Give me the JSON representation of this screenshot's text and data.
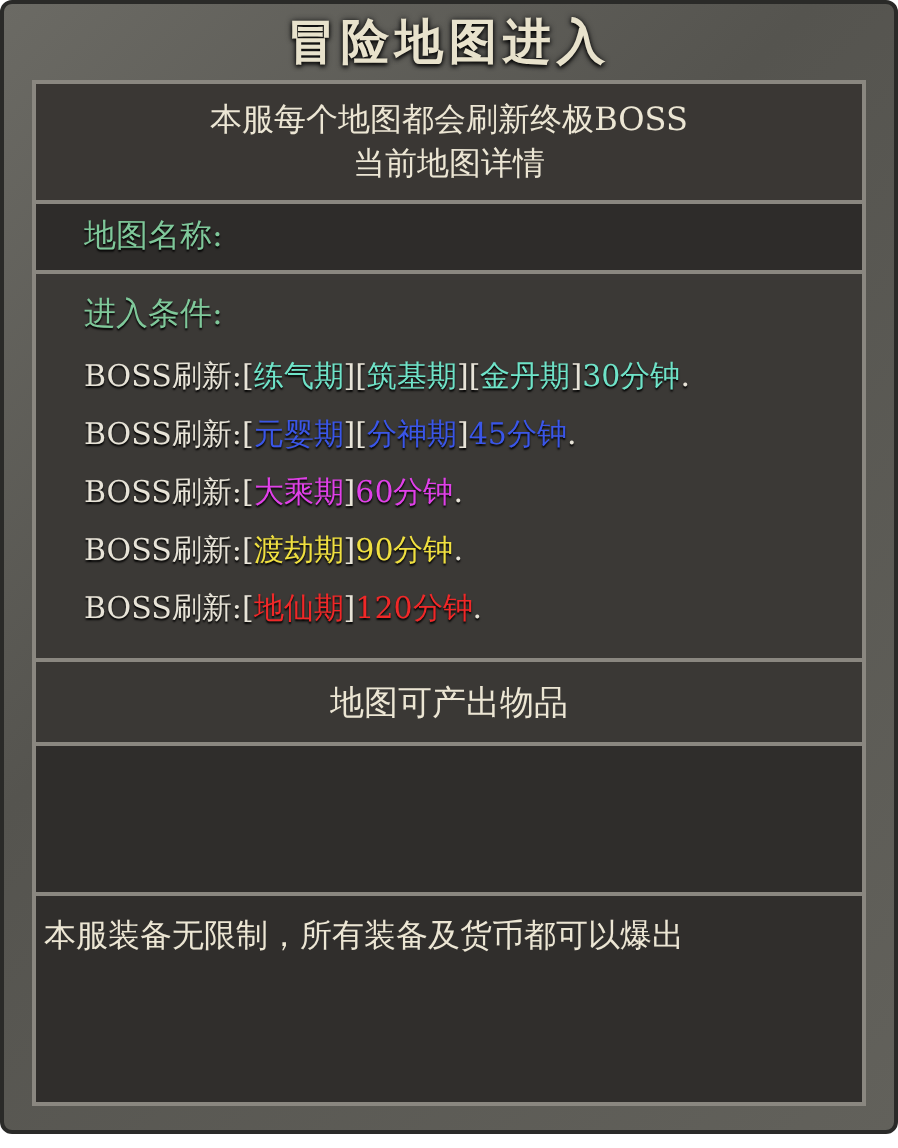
{
  "window": {
    "title": "冒险地图进入"
  },
  "header": {
    "lines": [
      "本服每个地图都会刷新终极BOSS",
      "当前地图详情"
    ]
  },
  "map_name": {
    "label": "地图名称:"
  },
  "conditions": {
    "label": "进入条件:",
    "rows": [
      {
        "segments": [
          {
            "text": "BOSS刷新:[",
            "color": "#e8e4d8"
          },
          {
            "text": "练气期",
            "color": "#6fe3c8"
          },
          {
            "text": "][",
            "color": "#e8e4d8"
          },
          {
            "text": "筑基期",
            "color": "#6fe3c8"
          },
          {
            "text": "][",
            "color": "#e8e4d8"
          },
          {
            "text": "金丹期",
            "color": "#6fe3c8"
          },
          {
            "text": "]",
            "color": "#e8e4d8"
          },
          {
            "text": "30分钟",
            "color": "#6fe3c8"
          },
          {
            "text": ".",
            "color": "#e8e4d8"
          }
        ]
      },
      {
        "segments": [
          {
            "text": "BOSS刷新:[",
            "color": "#e8e4d8"
          },
          {
            "text": "元婴期",
            "color": "#3a56e8"
          },
          {
            "text": "][",
            "color": "#e8e4d8"
          },
          {
            "text": "分神期",
            "color": "#3a56e8"
          },
          {
            "text": "]",
            "color": "#e8e4d8"
          },
          {
            "text": "45分钟",
            "color": "#3a56e8"
          },
          {
            "text": ".",
            "color": "#e8e4d8"
          }
        ]
      },
      {
        "segments": [
          {
            "text": "BOSS刷新:[",
            "color": "#e8e4d8"
          },
          {
            "text": "大乘期",
            "color": "#e040e8"
          },
          {
            "text": "]",
            "color": "#e8e4d8"
          },
          {
            "text": "60分钟",
            "color": "#e040e8"
          },
          {
            "text": ".",
            "color": "#e8e4d8"
          }
        ]
      },
      {
        "segments": [
          {
            "text": "BOSS刷新:[",
            "color": "#e8e4d8"
          },
          {
            "text": "渡劫期",
            "color": "#f0e040"
          },
          {
            "text": "]",
            "color": "#e8e4d8"
          },
          {
            "text": "90分钟",
            "color": "#f0e040"
          },
          {
            "text": ".",
            "color": "#e8e4d8"
          }
        ]
      },
      {
        "segments": [
          {
            "text": "BOSS刷新:[",
            "color": "#e8e4d8"
          },
          {
            "text": "地仙期",
            "color": "#f02828"
          },
          {
            "text": "]",
            "color": "#e8e4d8"
          },
          {
            "text": "120分钟",
            "color": "#f02828"
          },
          {
            "text": ".",
            "color": "#e8e4d8"
          }
        ]
      }
    ]
  },
  "drops": {
    "title": "地图可产出物品"
  },
  "note": {
    "text": "本服装备无限制，所有装备及货币都可以爆出"
  }
}
